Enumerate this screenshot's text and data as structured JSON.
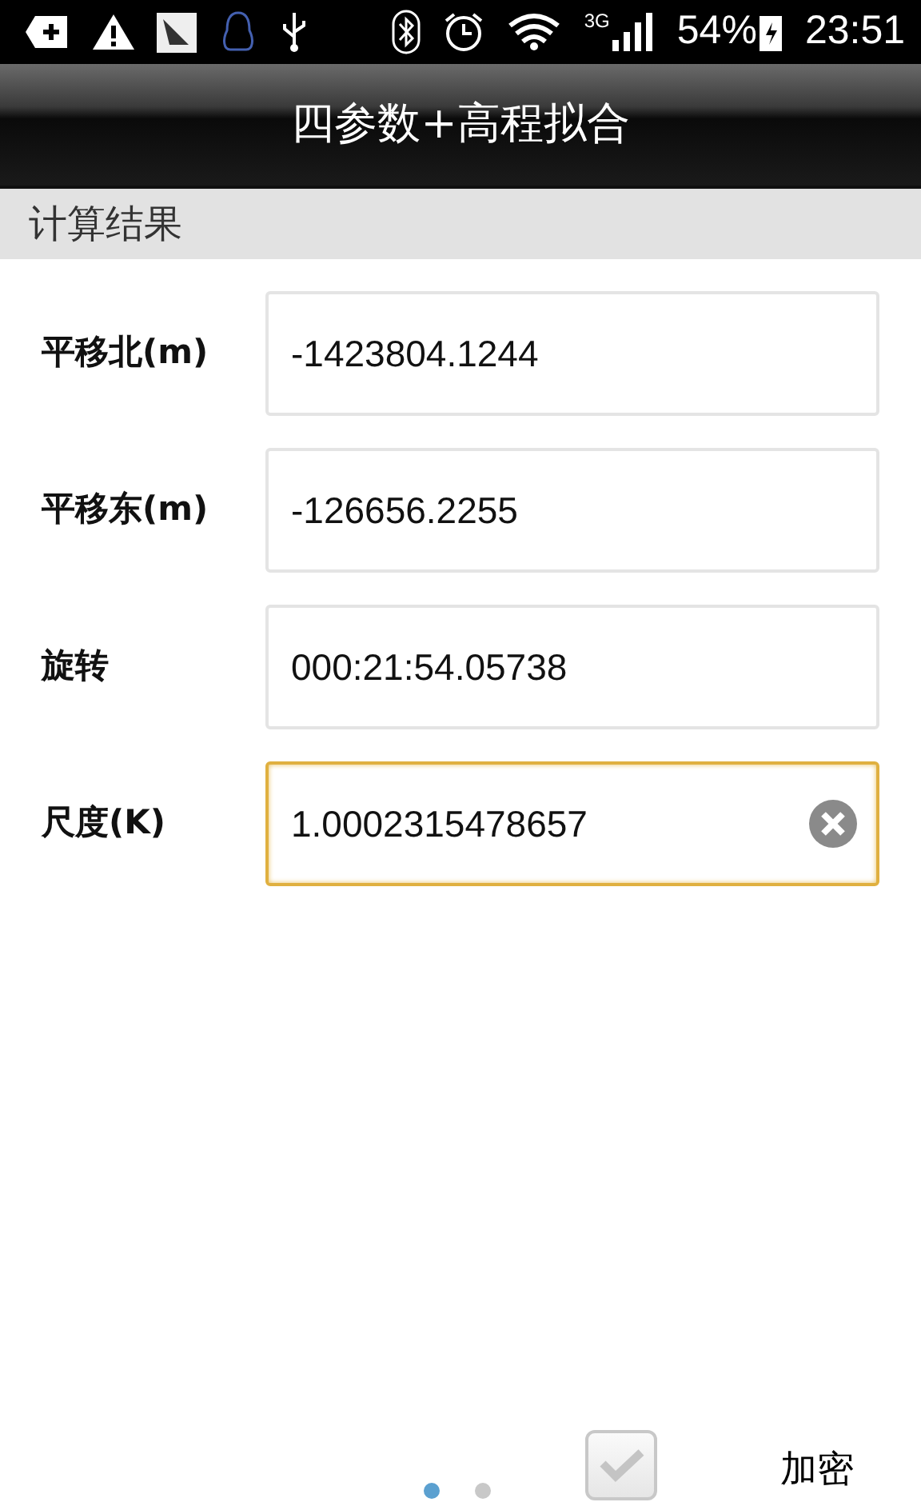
{
  "status_bar": {
    "network": "3G",
    "battery": "54%",
    "time": "23:51"
  },
  "title": "四参数+高程拟合",
  "section": "计算结果",
  "fields": [
    {
      "label": "平移北(m)",
      "value": "-1423804.1244",
      "focused": false
    },
    {
      "label": "平移东(m)",
      "value": "-126656.2255",
      "focused": false
    },
    {
      "label": "旋转",
      "value": "000:21:54.05738",
      "focused": false
    },
    {
      "label": "尺度(K)",
      "value": "1.0002315478657",
      "focused": true
    }
  ],
  "pager": [
    {
      "selected": true
    },
    {
      "selected": false
    }
  ],
  "encrypt": {
    "label": "加密",
    "checked": false
  }
}
